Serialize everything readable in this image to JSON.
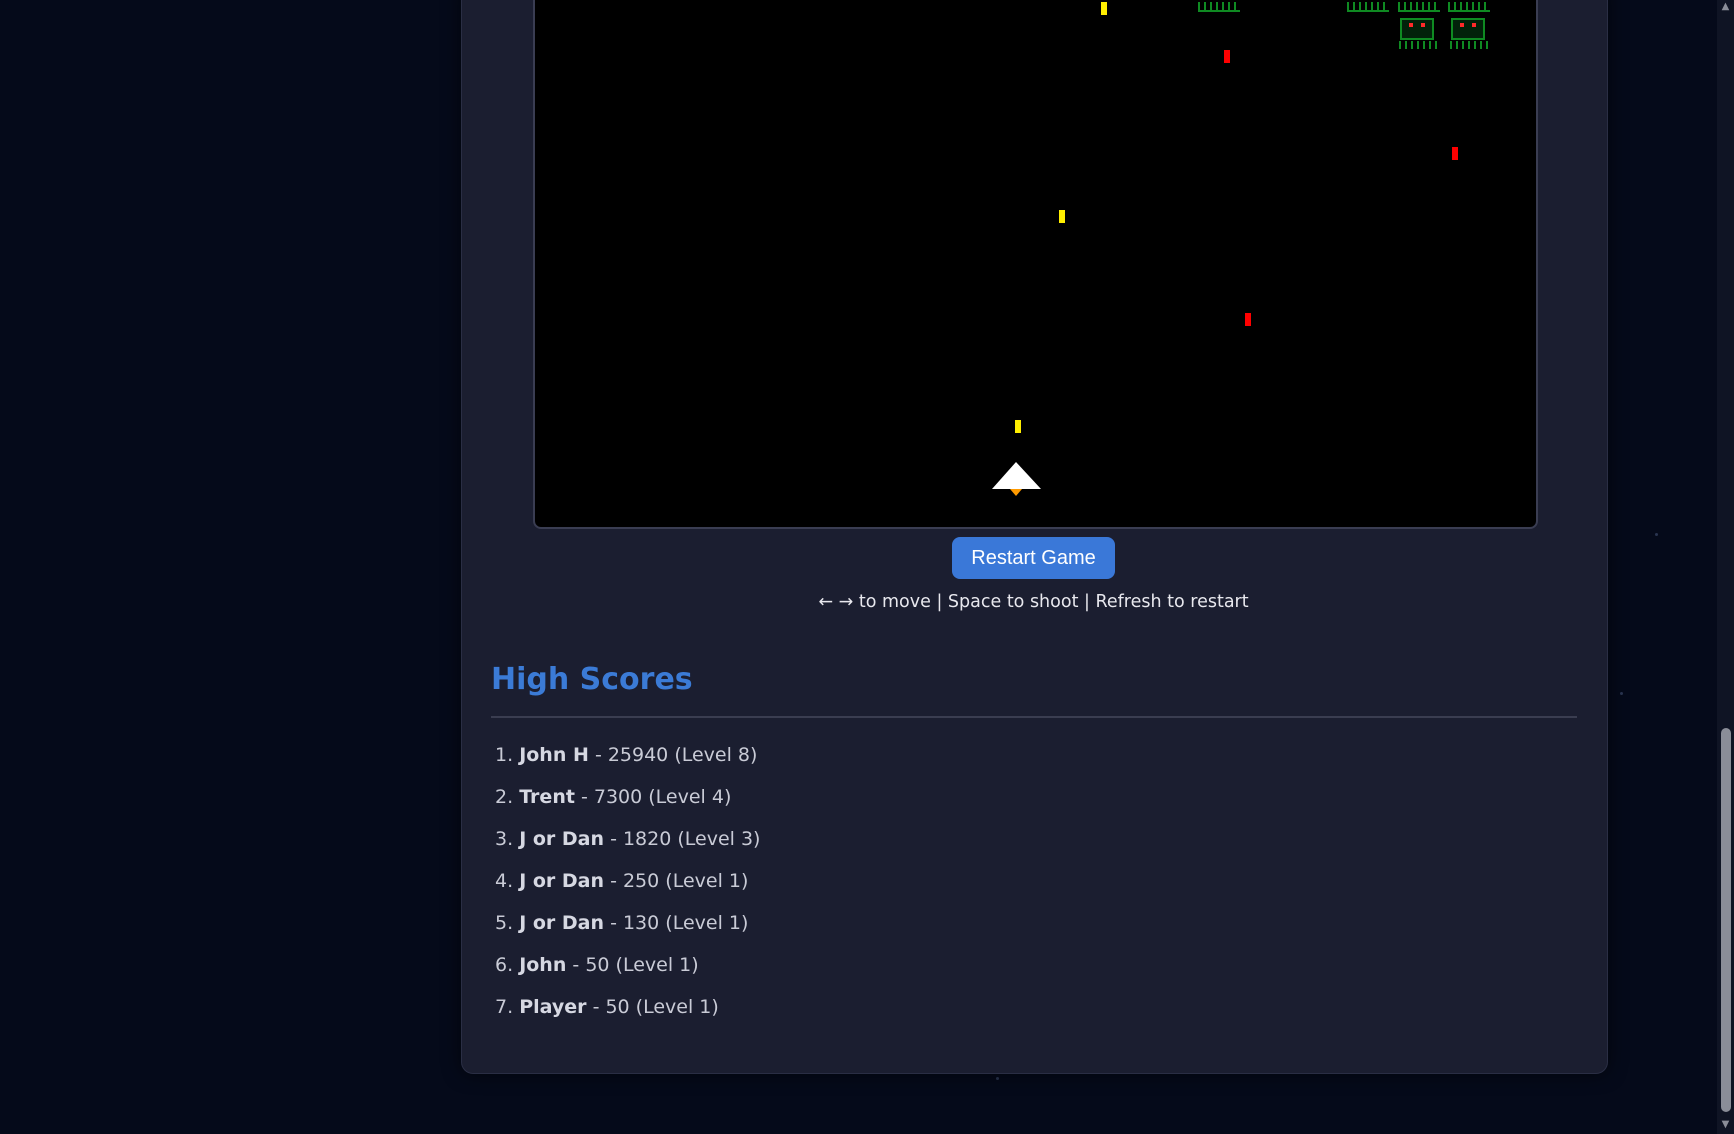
{
  "game": {
    "restart_label": "Restart Game",
    "instructions": {
      "arrows": "← →",
      "move_text": "to move",
      "sep1": "|",
      "shoot_text": "Space to shoot",
      "sep2": "|",
      "refresh_text": "Refresh to restart"
    },
    "colors": {
      "player": "#ffffff",
      "player_flame": "#ff9a00",
      "player_bullet": "#ffee00",
      "enemy_bullet": "#ff0000",
      "alien": "#0f8a22"
    }
  },
  "high_scores": {
    "title": "High Scores",
    "entries": [
      {
        "rank": "1.",
        "name": "John H",
        "detail": "- 25940 (Level 8)"
      },
      {
        "rank": "2.",
        "name": "Trent",
        "detail": "- 7300 (Level 4)"
      },
      {
        "rank": "3.",
        "name": "J or Dan",
        "detail": "- 1820 (Level 3)"
      },
      {
        "rank": "4.",
        "name": "J or Dan",
        "detail": "- 250 (Level 1)"
      },
      {
        "rank": "5.",
        "name": "J or Dan",
        "detail": "- 130 (Level 1)"
      },
      {
        "rank": "6.",
        "name": "John",
        "detail": "- 50 (Level 1)"
      },
      {
        "rank": "7.",
        "name": "Player",
        "detail": "- 50 (Level 1)"
      }
    ]
  },
  "scrollbar": {
    "up_icon": "scroll-up-icon",
    "down_icon": "scroll-down-icon"
  }
}
